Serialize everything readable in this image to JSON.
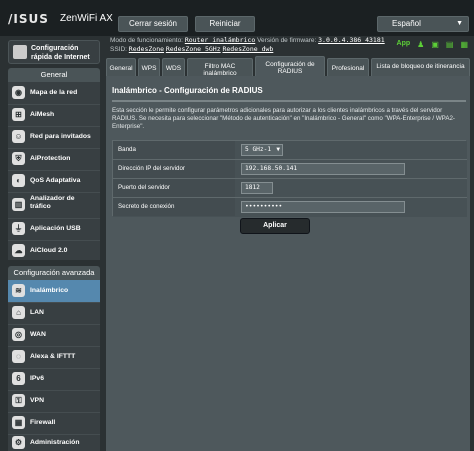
{
  "header": {
    "logo": "/ISUS",
    "product": "ZenWiFi AX",
    "logout_label": "Cerrar sesión",
    "reboot_label": "Reiniciar",
    "language": "Español"
  },
  "status": {
    "mode_label": "Modo de funcionamiento:",
    "mode_value": "Router inalámbrico",
    "fw_label": "Versión de firmware:",
    "fw_value": "3.0.0.4.386_43181",
    "ssid_label": "SSID:",
    "ssid_values": [
      "RedesZone",
      "RedesZone_5GHz",
      "RedesZone_dwb"
    ],
    "app_label": "App"
  },
  "sidebar": {
    "quick_setup": "Configuración rápida de Internet",
    "general_title": "General",
    "general_items": [
      {
        "label": "Mapa de la red",
        "icon": "network-map-icon"
      },
      {
        "label": "AiMesh",
        "icon": "aimesh-icon"
      },
      {
        "label": "Red para invitados",
        "icon": "guest-network-icon"
      },
      {
        "label": "AiProtection",
        "icon": "shield-icon"
      },
      {
        "label": "QoS Adaptativa",
        "icon": "qos-icon"
      },
      {
        "label": "Analizador de tráfico",
        "icon": "traffic-analyzer-icon"
      },
      {
        "label": "Aplicación USB",
        "icon": "usb-icon"
      },
      {
        "label": "AiCloud 2.0",
        "icon": "cloud-icon"
      }
    ],
    "advanced_title": "Configuración avanzada",
    "advanced_items": [
      {
        "label": "Inalámbrico",
        "icon": "wireless-icon",
        "active": true
      },
      {
        "label": "LAN",
        "icon": "lan-icon"
      },
      {
        "label": "WAN",
        "icon": "wan-icon"
      },
      {
        "label": "Alexa & IFTTT",
        "icon": "alexa-icon"
      },
      {
        "label": "IPv6",
        "icon": "ipv6-icon"
      },
      {
        "label": "VPN",
        "icon": "vpn-icon"
      },
      {
        "label": "Firewall",
        "icon": "firewall-icon"
      },
      {
        "label": "Administración",
        "icon": "administration-icon"
      }
    ]
  },
  "tabs": [
    {
      "label": "General"
    },
    {
      "label": "WPS"
    },
    {
      "label": "WDS"
    },
    {
      "label": "Filtro MAC inalámbrico"
    },
    {
      "label": "Configuración de RADIUS",
      "active": true
    },
    {
      "label": "Profesional"
    },
    {
      "label": "Lista de bloqueo de itinerancia"
    }
  ],
  "panel": {
    "title": "Inalámbrico - Configuración de RADIUS",
    "description": "Esta sección le permite configurar parámetros adicionales para autorizar a los clientes inalámbricos a través del servidor RADIUS. Se necesita para seleccionar \"Método de autenticación\" en \"Inalámbrico - General\" como \"WPA-Enterprise / WPA2-Enterprise\".",
    "fields": [
      {
        "label": "Banda",
        "value": "5 GHz-1"
      },
      {
        "label": "Dirección IP del servidor",
        "value": "192.168.50.141"
      },
      {
        "label": "Puerto del servidor",
        "value": "1812"
      },
      {
        "label": "Secreto de conexión",
        "value": "••••••••••"
      }
    ],
    "apply_label": "Aplicar"
  }
}
